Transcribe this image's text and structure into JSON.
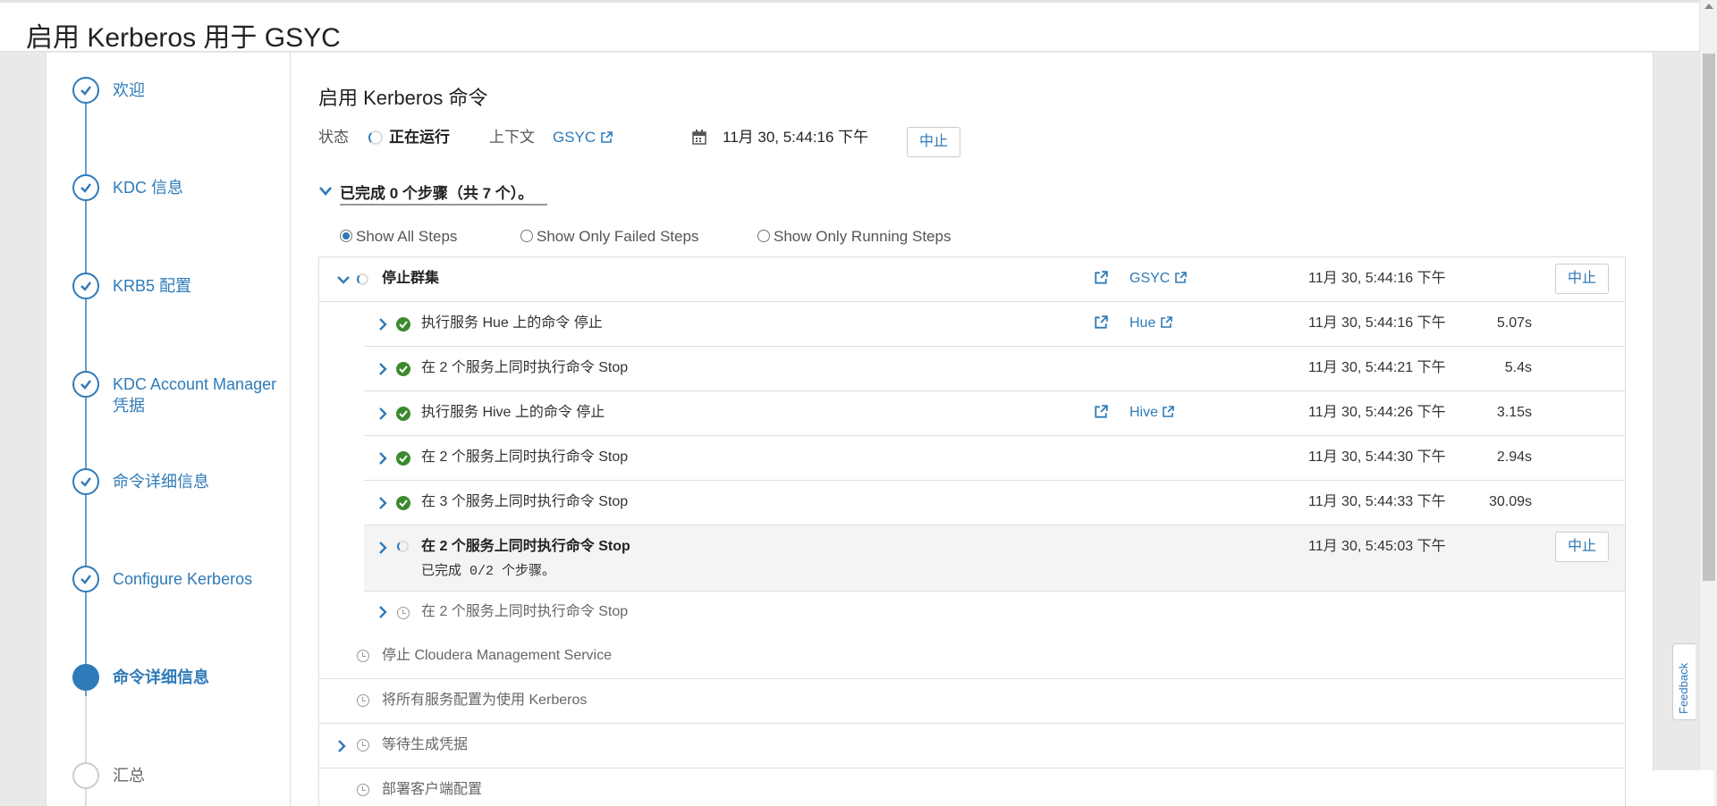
{
  "page_title": "启用 Kerberos 用于 GSYC",
  "wizard": {
    "steps": [
      {
        "label": "欢迎",
        "state": "done"
      },
      {
        "label": "KDC 信息",
        "state": "done"
      },
      {
        "label": "KRB5 配置",
        "state": "done"
      },
      {
        "label": "KDC Account Manager 凭据",
        "state": "done"
      },
      {
        "label": "命令详细信息",
        "state": "done"
      },
      {
        "label": "Configure Kerberos",
        "state": "done"
      },
      {
        "label": "命令详细信息",
        "state": "current"
      },
      {
        "label": "汇总",
        "state": "pending"
      }
    ]
  },
  "command": {
    "title": "启用 Kerberos 命令",
    "status_label": "状态",
    "status_value": "正在运行",
    "context_label": "上下文",
    "context_value": "GSYC",
    "start_time": "11月 30, 5:44:16 下午",
    "abort_label": "中止"
  },
  "progress": {
    "summary": "已完成 0 个步骤（共 7 个）。"
  },
  "filters": [
    {
      "label": "Show All Steps",
      "checked": true
    },
    {
      "label": "Show Only Failed Steps",
      "checked": false
    },
    {
      "label": "Show Only Running Steps",
      "checked": false
    }
  ],
  "steps": [
    {
      "name": "停止群集",
      "context": "GSYC",
      "time": "11月 30, 5:44:16 下午",
      "duration": "",
      "action": "中止",
      "status": "running"
    },
    {
      "name": "执行服务 Hue 上的命令 停止",
      "context": "Hue",
      "time": "11月 30, 5:44:16 下午",
      "duration": "5.07s",
      "status": "done"
    },
    {
      "name": "在 2 个服务上同时执行命令 Stop",
      "context": "",
      "time": "11月 30, 5:44:21 下午",
      "duration": "5.4s",
      "status": "done"
    },
    {
      "name": "执行服务 Hive 上的命令 停止",
      "context": "Hive",
      "time": "11月 30, 5:44:26 下午",
      "duration": "3.15s",
      "status": "done"
    },
    {
      "name": "在 2 个服务上同时执行命令 Stop",
      "context": "",
      "time": "11月 30, 5:44:30 下午",
      "duration": "2.94s",
      "status": "done"
    },
    {
      "name": "在 3 个服务上同时执行命令 Stop",
      "context": "",
      "time": "11月 30, 5:44:33 下午",
      "duration": "30.09s",
      "status": "done"
    },
    {
      "name": "在 2 个服务上同时执行命令 Stop",
      "subtext": "已完成 0/2 个步骤。",
      "context": "",
      "time": "11月 30, 5:45:03 下午",
      "duration": "",
      "action": "中止",
      "status": "running"
    },
    {
      "name": "在 2 个服务上同时执行命令 Stop",
      "status": "pending"
    },
    {
      "name": "停止 Cloudera Management Service",
      "status": "pending"
    },
    {
      "name": "将所有服务配置为使用 Kerberos",
      "status": "pending"
    },
    {
      "name": "等待生成凭据",
      "status": "pending"
    },
    {
      "name": "部署客户端配置",
      "status": "pending"
    }
  ],
  "feedback_label": "Feedback",
  "colors": {
    "accent": "#2f7ab8",
    "success": "#3c8a2e",
    "border": "#dddddd"
  }
}
